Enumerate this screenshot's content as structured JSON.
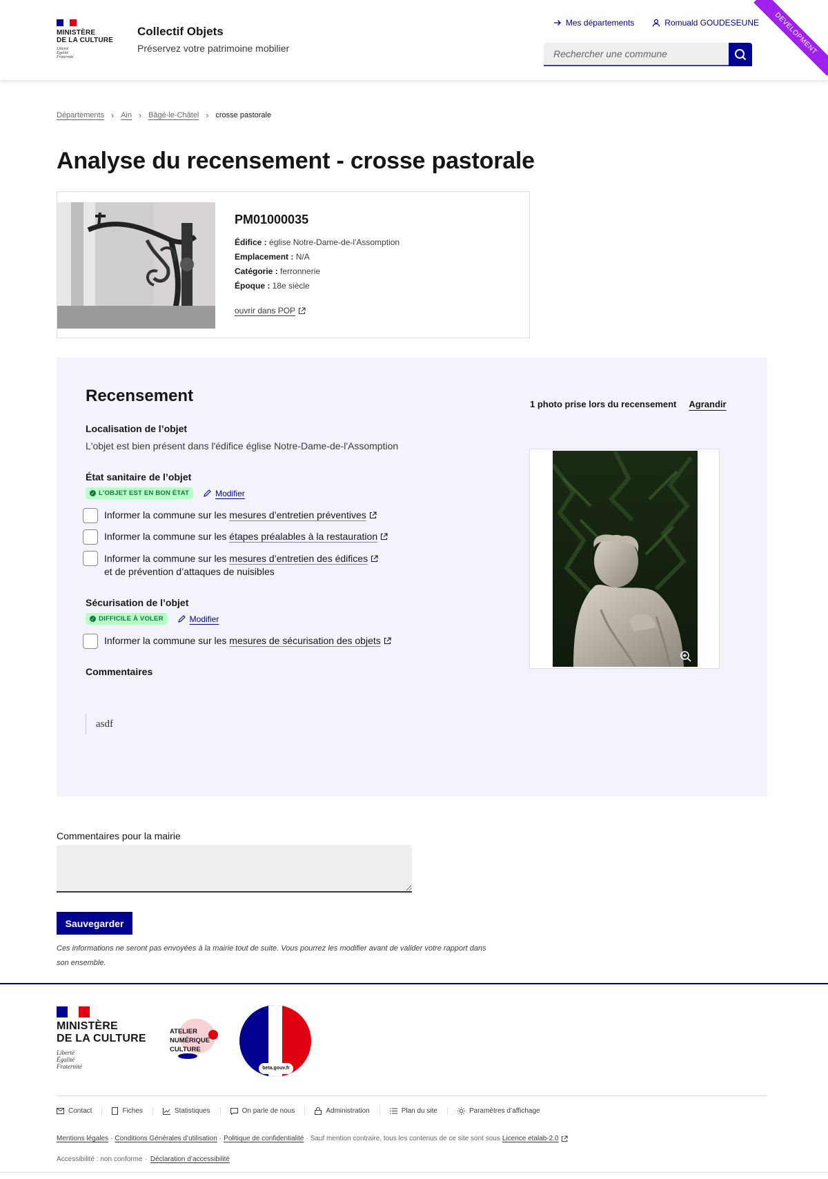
{
  "header": {
    "logo_title_line1": "MINISTÈRE",
    "logo_title_line2": "DE LA CULTURE",
    "logo_motto_1": "Liberté",
    "logo_motto_2": "Égalité",
    "logo_motto_3": "Fraternité",
    "service_title": "Collectif Objets",
    "service_tagline": "Préservez votre patrimoine mobilier",
    "link_departements": "Mes départements",
    "user_name": "Romuald GOUDESEUNE",
    "search_placeholder": "Rechercher une commune",
    "env_ribbon": "DEVELOPMENT"
  },
  "breadcrumb": {
    "items": [
      "Départements",
      "Ain",
      "Bâgé-le-Châtel"
    ],
    "current": "crosse pastorale"
  },
  "page_title": "Analyse du recensement - crosse pastorale",
  "object": {
    "reference": "PM01000035",
    "edifice_label": "Édifice :",
    "edifice": "église Notre-Dame-de-l'Assomption",
    "emplacement_label": "Emplacement :",
    "emplacement": "N/A",
    "categorie_label": "Catégorie :",
    "categorie": "ferronnerie",
    "epoque_label": "Époque :",
    "epoque": "18e siècle",
    "pop_link": "ouvrir dans POP"
  },
  "recensement": {
    "title": "Recensement",
    "localisation_label": "Localisation de l’objet",
    "localisation_text": "L'objet est bien présent dans l'édifice église Notre-Dame-de-l'Assomption",
    "etat_label": "État sanitaire de l’objet",
    "etat_badge": "L'objet est en bon état",
    "modifier": "Modifier",
    "inform_prefix": "Informer la commune sur les",
    "check_1_link": "mesures d’entretien préventives",
    "check_2_link": "étapes préalables à la restauration",
    "check_3_link": "mesures d’entretien des édifices",
    "check_3_suffix": "et de prévention d’attaques de nuisibles",
    "securisation_label": "Sécurisation de l’objet",
    "securisation_badge": "Difficile à voler",
    "check_4_link": "mesures de sécurisation des objets",
    "commentaires_label": "Commentaires",
    "commentaire": "asdf",
    "photo_caption": "1 photo prise lors du recensement",
    "agrandir": "Agrandir"
  },
  "mairie": {
    "label": "Commentaires pour la mairie",
    "value": "",
    "save_button": "Sauvegarder",
    "note": "Ces informations ne seront pas envoyées à la mairie tout de suite. Vous pourrez les modifier avant de valider votre rapport dans son ensemble."
  },
  "footer": {
    "atelier_line1": "ATELIER",
    "atelier_line2": "NUMÉRIQUE",
    "atelier_line3": "CULTURE",
    "beta_label": "beta.gouv.fr",
    "links": [
      "Contact",
      "Fiches",
      "Statistiques",
      "On parle de nous",
      "Administration",
      "Plan du site",
      "Paramètres d’affichage"
    ],
    "legal_mentions": "Mentions légales",
    "legal_cgu": "Conditions Générales d’utilisation",
    "legal_privacy": "Politique de confidentialité",
    "legal_text": "Sauf mention contraire, tous les contenus de ce site sont sous",
    "legal_licence": "Licence etalab-2.0",
    "accessibility_text": "Accessibilité : non conforme",
    "accessibility_link": "Déclaration d’accessibilité"
  },
  "colors": {
    "primary": "#000091",
    "badge_bg": "#b8fec9",
    "badge_fg": "#18753c",
    "panel_bg": "#f3f3fb",
    "ribbon": "#a020f0"
  }
}
